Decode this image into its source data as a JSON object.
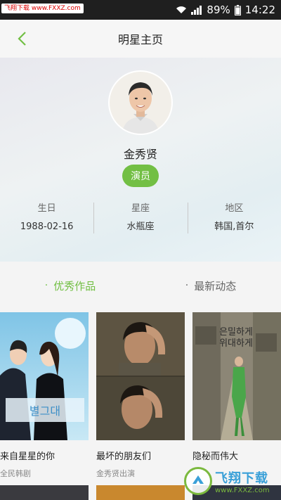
{
  "status_bar": {
    "watermark": "飞翔下载 www.FXXZ.com",
    "battery_percent": "89%",
    "time": "14:22"
  },
  "nav": {
    "title": "明星主页"
  },
  "profile": {
    "name": "金秀贤",
    "role": "演员",
    "info": [
      {
        "label": "生日",
        "value": "1988-02-16"
      },
      {
        "label": "星座",
        "value": "水瓶座"
      },
      {
        "label": "地区",
        "value": "韩国,首尔"
      }
    ]
  },
  "tabs": [
    {
      "label": "优秀作品",
      "active": true
    },
    {
      "label": "最新动态",
      "active": false
    }
  ],
  "works": [
    {
      "title": "来自星星的你",
      "subtitle": "全民韩剧"
    },
    {
      "title": "最坏的朋友们",
      "subtitle": "金秀贤出演"
    },
    {
      "title": "隐秘而伟大",
      "subtitle": ""
    }
  ],
  "colors": {
    "accent": "#72bf44",
    "status_bar": "#1f1f1f"
  },
  "site_logo": {
    "text": "飞翔下载",
    "url": "www.FXXZ.com"
  }
}
